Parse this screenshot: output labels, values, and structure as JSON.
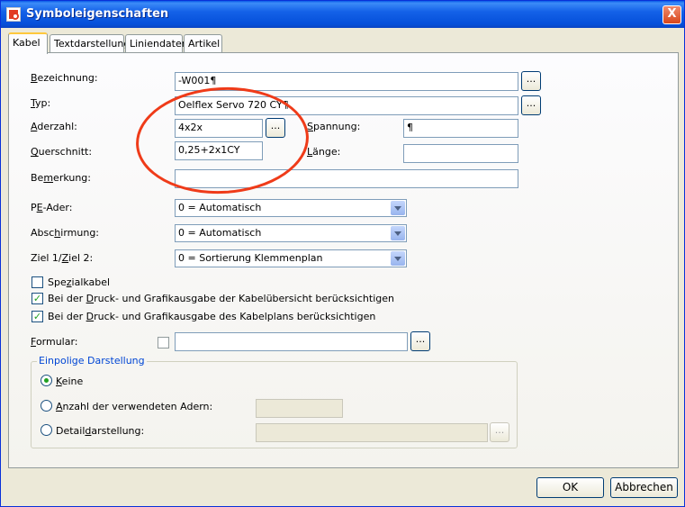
{
  "window": {
    "title": "Symboleigenschaften",
    "close_label": "X"
  },
  "tabs": [
    "Kabel",
    "Textdarstellung",
    "Liniendaten",
    "Artikel"
  ],
  "form": {
    "bezeichnung": {
      "label_u": "B",
      "label_rest": "ezeichnung:",
      "value": "-W001¶"
    },
    "typ": {
      "label_u": "T",
      "label_rest": "yp:",
      "value": "Oelflex Servo 720 CY¶"
    },
    "aderzahl": {
      "label_u": "A",
      "label_rest": "derzahl:",
      "value": "4x2x"
    },
    "spannung": {
      "label_u": "S",
      "label_rest": "pannung:",
      "value": "¶"
    },
    "querschnitt": {
      "label_u": "Q",
      "label_rest": "uerschnitt:",
      "value": "0,25+2x1CY"
    },
    "laenge": {
      "label_u": "L",
      "label_rest": "änge:",
      "value": ""
    },
    "bemerkung": {
      "label_pre": "Be",
      "label_u": "m",
      "label_rest": "erkung:",
      "value": ""
    },
    "pe_ader": {
      "label_pre": "P",
      "label_u": "E",
      "label_rest": "-Ader:",
      "value": "0 = Automatisch"
    },
    "abschirmung": {
      "label_pre": "Absc",
      "label_u": "h",
      "label_rest": "irmung:",
      "value": "0 = Automatisch"
    },
    "ziel": {
      "label_pre": "Ziel 1/",
      "label_u": "Z",
      "label_rest": "iel 2:",
      "value": "0 = Sortierung Klemmenplan"
    },
    "spezialkabel": {
      "label_pre": "Spe",
      "label_u": "z",
      "label_rest": "ialkabel",
      "checked": false
    },
    "opt_uebersicht": {
      "label_pre": "Bei der ",
      "label_u": "D",
      "label_rest": "ruck- und Grafikausgabe der Kabelübersicht berücksichtigen",
      "checked": true
    },
    "opt_kabelplan": {
      "label_pre": "Bei der ",
      "label_u": "D",
      "label_rest": "ruck- und Grafikausgabe des Kabelplans berücksichtigen",
      "checked": true
    },
    "formular": {
      "label_u": "F",
      "label_rest": "ormular:",
      "value": ""
    },
    "dots": "..."
  },
  "einpolig": {
    "title": "Einpolige Darstellung",
    "keine": {
      "label_u": "K",
      "label_rest": "eine",
      "selected": true
    },
    "anzahl": {
      "label_u": "A",
      "label_rest": "nzahl der verwendeten Adern:",
      "selected": false
    },
    "detail": {
      "label_pre": "Detail",
      "label_u": "d",
      "label_rest": "arstellung:",
      "selected": false
    }
  },
  "buttons": {
    "ok": "OK",
    "cancel": "Abbrechen"
  },
  "colors": {
    "annotation": "#ef3b19",
    "titlebar": "#0a5ae8",
    "check": "#21a121"
  }
}
